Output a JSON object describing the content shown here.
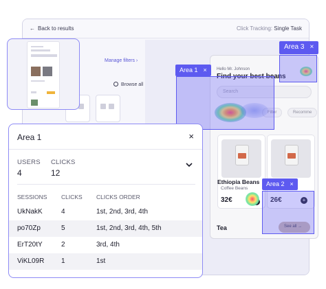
{
  "window": {
    "back_label": "Back to results",
    "tracking_label": "Click Tracking:",
    "tracking_value": "Single Task",
    "manage_filters": "Manage filters",
    "browse_all": "Browse all"
  },
  "app": {
    "greeting": "Hello Mr. Johnson",
    "headline": "Find your best beans",
    "search_placeholder": "Search",
    "chips": [
      "Filter",
      "Recomme"
    ],
    "products": [
      {
        "name": "Ethiopia Beans",
        "category": "Coffee Beans",
        "price": "32€"
      },
      {
        "price": "26€"
      }
    ],
    "section": "Tea",
    "see_all": "See all"
  },
  "areas": [
    {
      "label": "Area 1",
      "close": "×"
    },
    {
      "label": "Area 2",
      "close": "×"
    },
    {
      "label": "Area 3",
      "close": "×"
    }
  ],
  "panel": {
    "title": "Area 1",
    "close": "×",
    "users_label": "USERS",
    "users_value": "4",
    "clicks_label": "CLICKS",
    "clicks_value": "12",
    "columns": [
      "SESSIONS",
      "CLICKS",
      "CLICKS ORDER"
    ],
    "rows": [
      {
        "session": "UkNakK",
        "clicks": "4",
        "order": "1st, 2nd, 3rd, 4th"
      },
      {
        "session": "po70Zp",
        "clicks": "5",
        "order": "1st, 2nd, 3rd, 4th, 5th"
      },
      {
        "session": "ErT20tY",
        "clicks": "2",
        "order": "3rd, 4th"
      },
      {
        "session": "ViKL09R",
        "clicks": "1",
        "order": "1st"
      }
    ]
  },
  "colors": {
    "accent": "#5d5af0",
    "overlay": "#6c68f5",
    "price_tag": "#d2694a"
  }
}
